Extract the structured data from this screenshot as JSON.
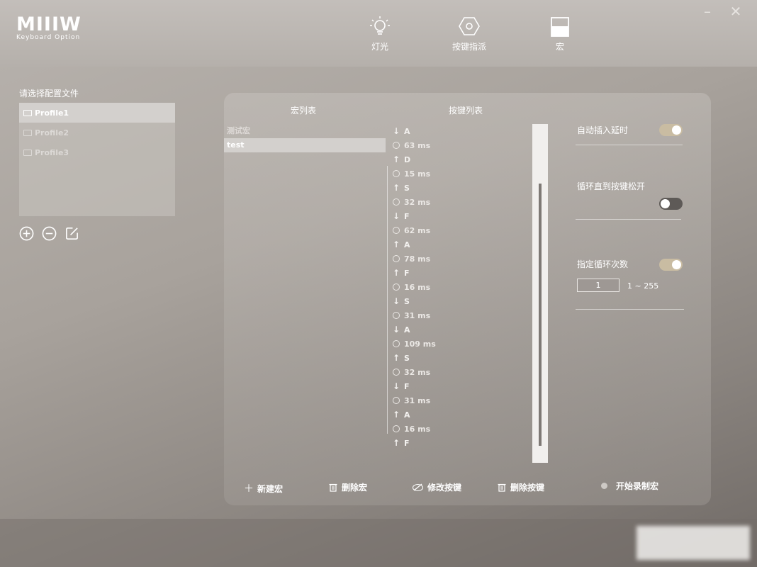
{
  "app": {
    "logo_mark": "MIIIW",
    "logo_sub": "Keyboard Option",
    "window_controls": [
      "minimize-icon",
      "close-icon"
    ]
  },
  "nav": {
    "items": [
      {
        "label": "灯光",
        "icon": "bulb-icon"
      },
      {
        "label": "按键指派",
        "icon": "hexagon-nut-icon"
      },
      {
        "label": "宏",
        "icon": "macro-icon"
      }
    ]
  },
  "profiles": {
    "title": "请选择配置文件",
    "items": [
      {
        "label": "Profile1",
        "active": true
      },
      {
        "label": "Profile2",
        "active": false
      },
      {
        "label": "Profile3",
        "active": false
      }
    ],
    "actions": [
      "add-circle-icon",
      "remove-circle-icon",
      "edit-icon"
    ]
  },
  "macro": {
    "macro_list_header": "宏列表",
    "key_list_header": "按键列表",
    "macros": [
      {
        "label": "测试宏",
        "selected": false
      },
      {
        "label": "test",
        "selected": true
      }
    ],
    "keys": [
      {
        "type": "down",
        "text": "A"
      },
      {
        "type": "delay",
        "text": "63 ms"
      },
      {
        "type": "up",
        "text": "D"
      },
      {
        "type": "delay",
        "text": "15 ms"
      },
      {
        "type": "up",
        "text": "S"
      },
      {
        "type": "delay",
        "text": "32 ms"
      },
      {
        "type": "down",
        "text": "F"
      },
      {
        "type": "delay",
        "text": "62 ms"
      },
      {
        "type": "up",
        "text": "A"
      },
      {
        "type": "delay",
        "text": "78 ms"
      },
      {
        "type": "up",
        "text": "F"
      },
      {
        "type": "delay",
        "text": "16 ms"
      },
      {
        "type": "down",
        "text": "S"
      },
      {
        "type": "delay",
        "text": "31 ms"
      },
      {
        "type": "down",
        "text": "A"
      },
      {
        "type": "delay",
        "text": "109 ms"
      },
      {
        "type": "up",
        "text": "S"
      },
      {
        "type": "delay",
        "text": "32 ms"
      },
      {
        "type": "down",
        "text": "F"
      },
      {
        "type": "delay",
        "text": "31 ms"
      },
      {
        "type": "up",
        "text": "A"
      },
      {
        "type": "delay",
        "text": "16 ms"
      },
      {
        "type": "up",
        "text": "F"
      }
    ],
    "options": {
      "auto_delay_label": "自动插入延时",
      "auto_delay_on": true,
      "loop_until_release_label": "循环直到按键松开",
      "loop_until_release_on": false,
      "loop_count_label": "指定循环次数",
      "loop_count_on": true,
      "loop_count_value": "1",
      "loop_count_range": "1 ~ 255"
    },
    "buttons": {
      "new_macro": "新建宏",
      "delete_macro": "删除宏",
      "modify_key": "修改按键",
      "delete_key": "删除按键",
      "start_record": "开始录制宏"
    }
  },
  "colors": {
    "toggle_on": "#c9bca2",
    "toggle_off": "#5e5a57",
    "selected_row": "#d3d0cd"
  }
}
